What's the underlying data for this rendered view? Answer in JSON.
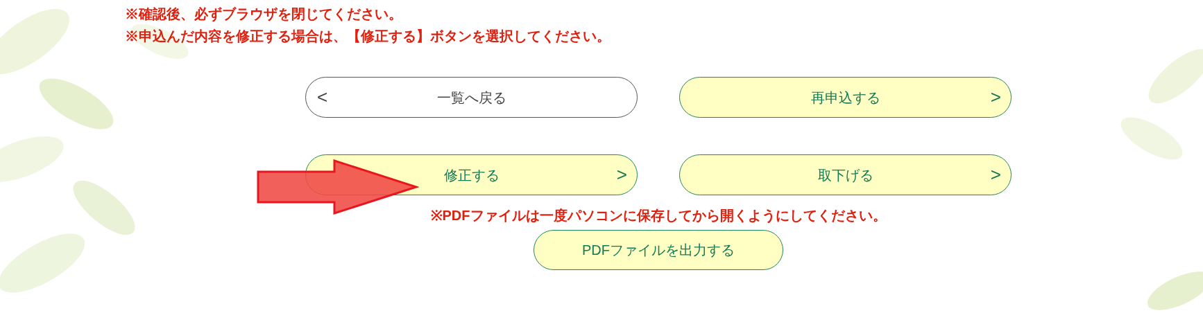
{
  "notices": [
    "※確認後、必ずブラウザを閉じてください。",
    "※申込んだ内容を修正する場合は、【修正する】ボタンを選択してください。"
  ],
  "buttons": [
    {
      "label": "一覧へ戻る",
      "kind": "back",
      "chevron": "<"
    },
    {
      "label": "再申込する",
      "kind": "next",
      "chevron": ">"
    },
    {
      "label": "修正する",
      "kind": "next",
      "chevron": ">"
    },
    {
      "label": "取下げる",
      "kind": "next",
      "chevron": ">"
    }
  ],
  "pdf_notice": "※PDFファイルは一度パソコンに保存してから開くようにしてください。",
  "pdf_button": {
    "label": "PDFファイルを出力する",
    "kind": "plain"
  }
}
